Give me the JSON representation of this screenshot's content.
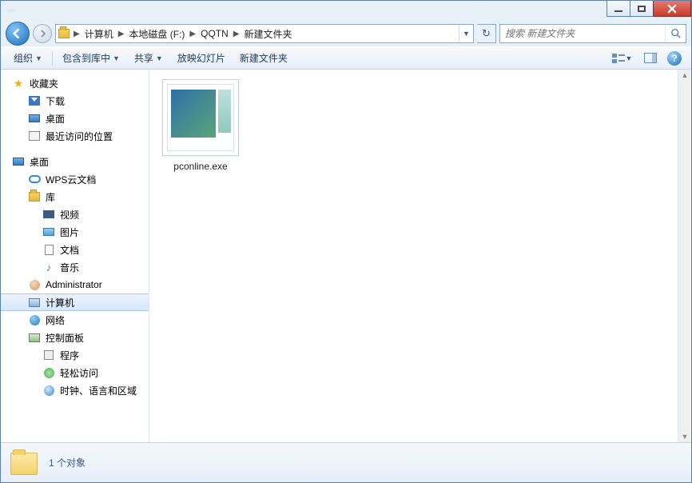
{
  "window": {
    "title": "..."
  },
  "breadcrumb": {
    "root": "计算机",
    "parts": [
      "本地磁盘 (F:)",
      "QQTN",
      "新建文件夹"
    ]
  },
  "search": {
    "placeholder": "搜索 新建文件夹"
  },
  "toolbar": {
    "organize": "组织",
    "include": "包含到库中",
    "share": "共享",
    "slideshow": "放映幻灯片",
    "newfolder": "新建文件夹"
  },
  "nav": {
    "favorites": {
      "label": "收藏夹",
      "items": [
        {
          "icon": "download",
          "label": "下载"
        },
        {
          "icon": "desktop",
          "label": "桌面"
        },
        {
          "icon": "recent",
          "label": "最近访问的位置"
        }
      ]
    },
    "desktop": {
      "label": "桌面",
      "items": [
        {
          "icon": "cloud",
          "label": "WPS云文档"
        },
        {
          "icon": "lib",
          "label": "库",
          "children": [
            {
              "icon": "video",
              "label": "视频"
            },
            {
              "icon": "picture",
              "label": "图片"
            },
            {
              "icon": "doc",
              "label": "文档"
            },
            {
              "icon": "music",
              "label": "音乐"
            }
          ]
        },
        {
          "icon": "user",
          "label": "Administrator"
        },
        {
          "icon": "pc",
          "label": "计算机",
          "selected": true
        },
        {
          "icon": "net",
          "label": "网络"
        },
        {
          "icon": "cp",
          "label": "控制面板",
          "children": [
            {
              "icon": "prog",
              "label": "程序"
            },
            {
              "icon": "ease",
              "label": "轻松访问"
            },
            {
              "icon": "clock",
              "label": "时钟、语言和区域"
            }
          ]
        }
      ]
    }
  },
  "files": [
    {
      "name": "pconline.exe"
    }
  ],
  "status": {
    "count_text": "1 个对象"
  }
}
